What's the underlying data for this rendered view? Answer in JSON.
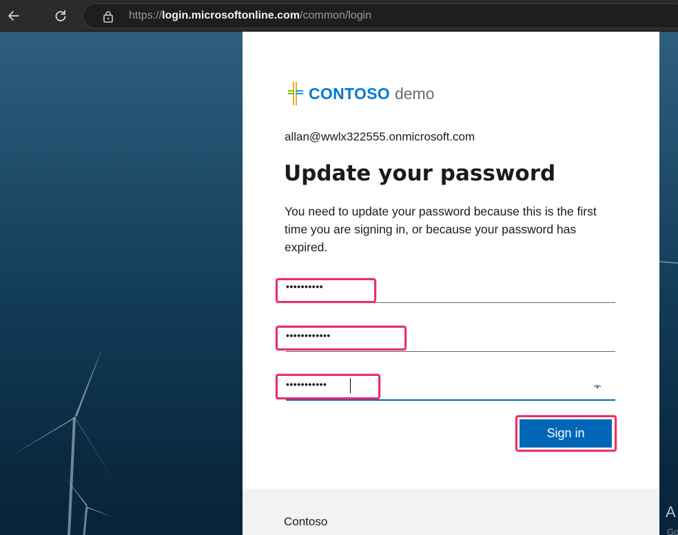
{
  "browser": {
    "url_prefix": "https://",
    "url_domain": "login.microsoftonline.com",
    "url_path": "/common/login"
  },
  "brand": {
    "name": "CONTOSO",
    "suffix": "demo"
  },
  "account": "allan@wwlx322555.onmicrosoft.com",
  "title": "Update your password",
  "description": "You need to update your password because this is the first time you are signing in, or because your password has expired.",
  "fields": {
    "current_password": "••••••••••",
    "new_password": "••••••••••••",
    "confirm_password": "•••••••••••"
  },
  "signin_label": "Sign in",
  "footer_text": "Contoso",
  "background_text": {
    "large": "A",
    "small": "Go"
  },
  "colors": {
    "accent": "#0067b8",
    "highlight": "#e8306a",
    "card": "#ffffff"
  }
}
